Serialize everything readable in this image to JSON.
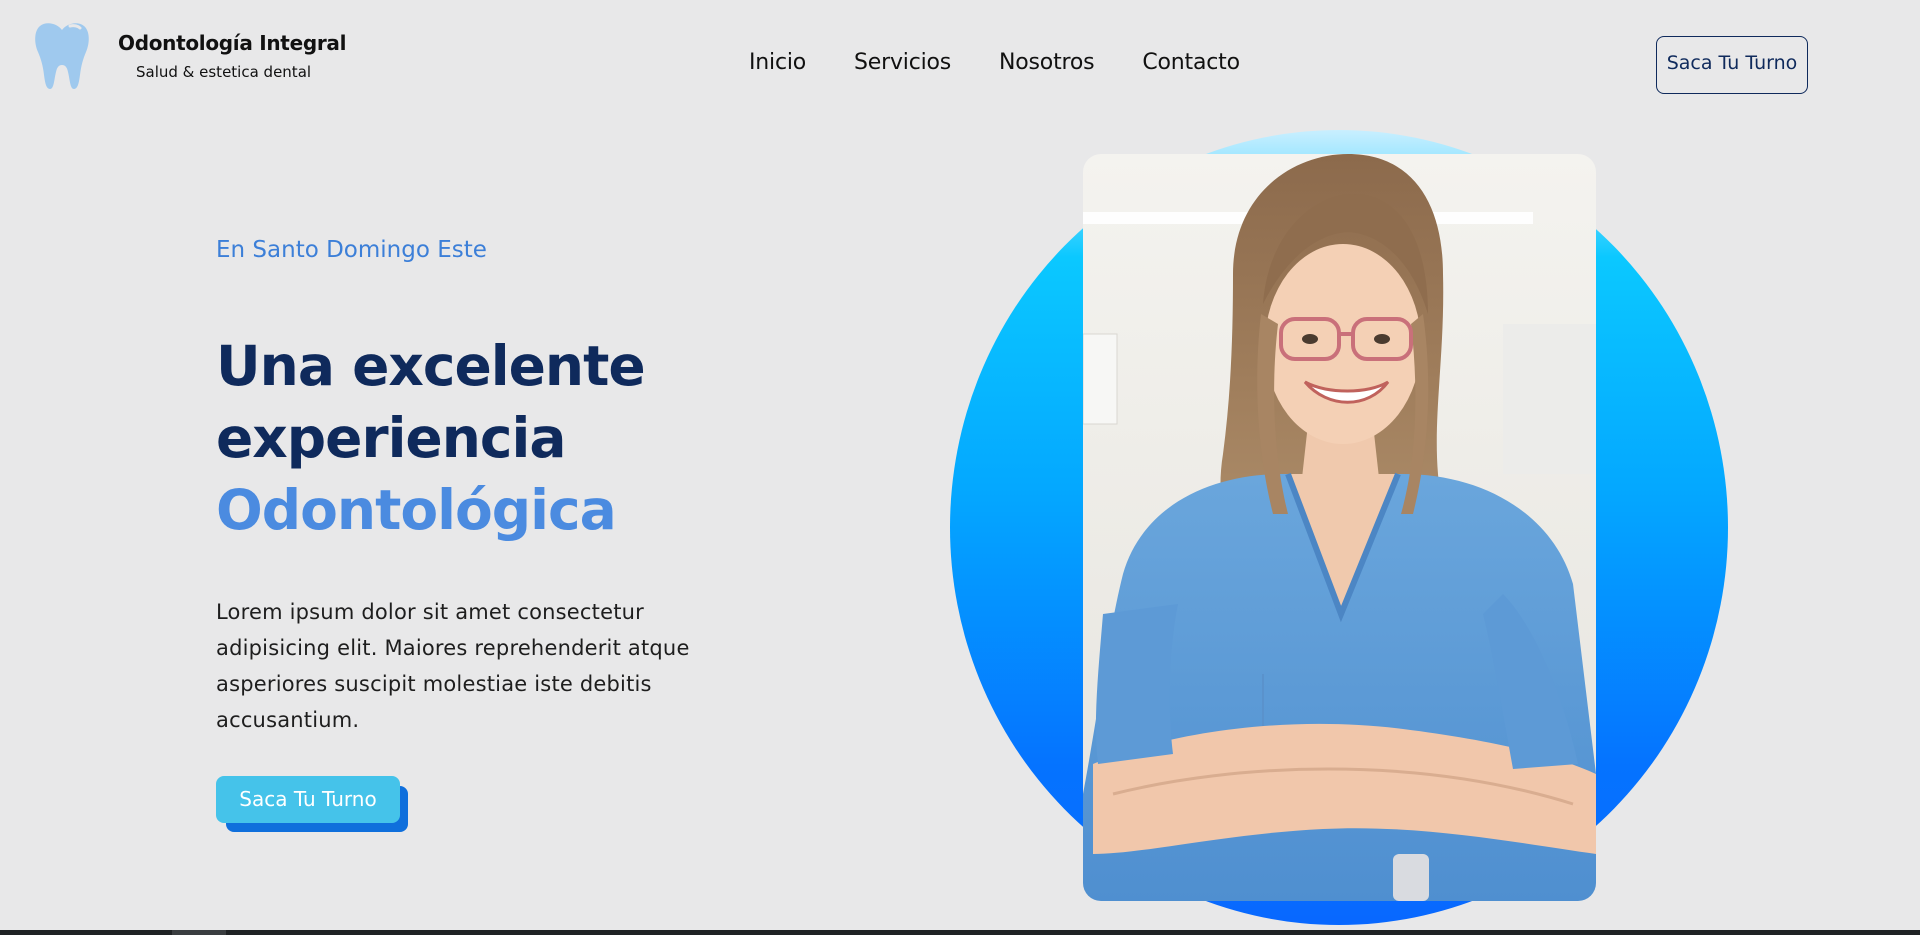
{
  "brand": {
    "name": "Odontología Integral",
    "tagline": "Salud & estetica dental",
    "logo_icon": "tooth-icon"
  },
  "nav": {
    "items": [
      {
        "label": "Inicio"
      },
      {
        "label": "Servicios"
      },
      {
        "label": "Nosotros"
      },
      {
        "label": "Contacto"
      }
    ]
  },
  "header": {
    "cta_label": "Saca Tu Turno"
  },
  "hero": {
    "eyebrow": "En Santo Domingo Este",
    "headline_line1": "Una excelente",
    "headline_line2": "experiencia",
    "headline_line3": "Odontológica",
    "description": "Lorem ipsum dolor sit amet consectetur adipisicing elit. Maiores reprehenderit atque asperiores suscipit molestiae iste debitis accusantium.",
    "cta_label": "Saca Tu Turno"
  },
  "colors": {
    "page_background": "#e8e8e9",
    "navy": "#0f2a5c",
    "accent_blue": "#4b8be0",
    "cta_cyan": "#45c3ea",
    "cta_shadow_blue": "#0f6fdc",
    "blob_top": "#0bc8ff",
    "blob_bottom": "#0868ff",
    "logo_blue": "#9fc9ee"
  }
}
